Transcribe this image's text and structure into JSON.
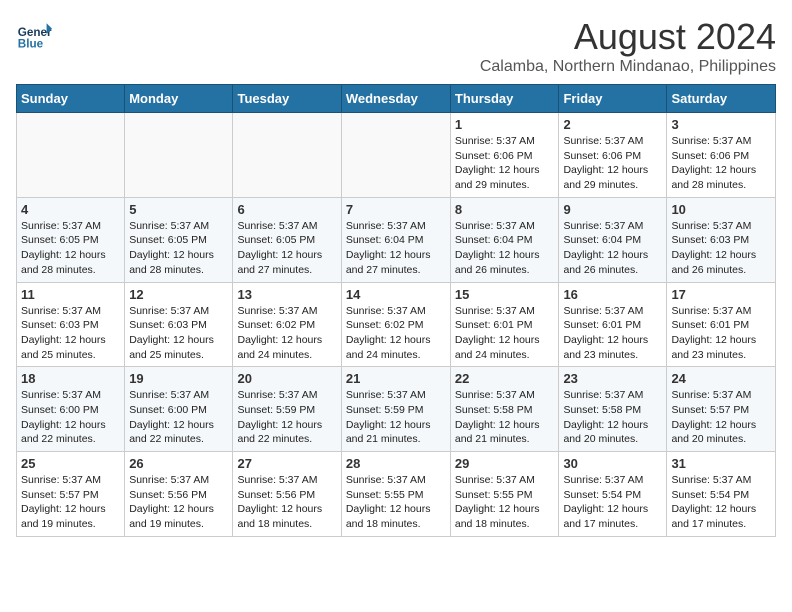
{
  "logo": {
    "line1": "General",
    "line2": "Blue"
  },
  "header": {
    "month_year": "August 2024",
    "location": "Calamba, Northern Mindanao, Philippines"
  },
  "weekdays": [
    "Sunday",
    "Monday",
    "Tuesday",
    "Wednesday",
    "Thursday",
    "Friday",
    "Saturday"
  ],
  "weeks": [
    [
      {
        "day": "",
        "info": ""
      },
      {
        "day": "",
        "info": ""
      },
      {
        "day": "",
        "info": ""
      },
      {
        "day": "",
        "info": ""
      },
      {
        "day": "1",
        "info": "Sunrise: 5:37 AM\nSunset: 6:06 PM\nDaylight: 12 hours\nand 29 minutes."
      },
      {
        "day": "2",
        "info": "Sunrise: 5:37 AM\nSunset: 6:06 PM\nDaylight: 12 hours\nand 29 minutes."
      },
      {
        "day": "3",
        "info": "Sunrise: 5:37 AM\nSunset: 6:06 PM\nDaylight: 12 hours\nand 28 minutes."
      }
    ],
    [
      {
        "day": "4",
        "info": "Sunrise: 5:37 AM\nSunset: 6:05 PM\nDaylight: 12 hours\nand 28 minutes."
      },
      {
        "day": "5",
        "info": "Sunrise: 5:37 AM\nSunset: 6:05 PM\nDaylight: 12 hours\nand 28 minutes."
      },
      {
        "day": "6",
        "info": "Sunrise: 5:37 AM\nSunset: 6:05 PM\nDaylight: 12 hours\nand 27 minutes."
      },
      {
        "day": "7",
        "info": "Sunrise: 5:37 AM\nSunset: 6:04 PM\nDaylight: 12 hours\nand 27 minutes."
      },
      {
        "day": "8",
        "info": "Sunrise: 5:37 AM\nSunset: 6:04 PM\nDaylight: 12 hours\nand 26 minutes."
      },
      {
        "day": "9",
        "info": "Sunrise: 5:37 AM\nSunset: 6:04 PM\nDaylight: 12 hours\nand 26 minutes."
      },
      {
        "day": "10",
        "info": "Sunrise: 5:37 AM\nSunset: 6:03 PM\nDaylight: 12 hours\nand 26 minutes."
      }
    ],
    [
      {
        "day": "11",
        "info": "Sunrise: 5:37 AM\nSunset: 6:03 PM\nDaylight: 12 hours\nand 25 minutes."
      },
      {
        "day": "12",
        "info": "Sunrise: 5:37 AM\nSunset: 6:03 PM\nDaylight: 12 hours\nand 25 minutes."
      },
      {
        "day": "13",
        "info": "Sunrise: 5:37 AM\nSunset: 6:02 PM\nDaylight: 12 hours\nand 24 minutes."
      },
      {
        "day": "14",
        "info": "Sunrise: 5:37 AM\nSunset: 6:02 PM\nDaylight: 12 hours\nand 24 minutes."
      },
      {
        "day": "15",
        "info": "Sunrise: 5:37 AM\nSunset: 6:01 PM\nDaylight: 12 hours\nand 24 minutes."
      },
      {
        "day": "16",
        "info": "Sunrise: 5:37 AM\nSunset: 6:01 PM\nDaylight: 12 hours\nand 23 minutes."
      },
      {
        "day": "17",
        "info": "Sunrise: 5:37 AM\nSunset: 6:01 PM\nDaylight: 12 hours\nand 23 minutes."
      }
    ],
    [
      {
        "day": "18",
        "info": "Sunrise: 5:37 AM\nSunset: 6:00 PM\nDaylight: 12 hours\nand 22 minutes."
      },
      {
        "day": "19",
        "info": "Sunrise: 5:37 AM\nSunset: 6:00 PM\nDaylight: 12 hours\nand 22 minutes."
      },
      {
        "day": "20",
        "info": "Sunrise: 5:37 AM\nSunset: 5:59 PM\nDaylight: 12 hours\nand 22 minutes."
      },
      {
        "day": "21",
        "info": "Sunrise: 5:37 AM\nSunset: 5:59 PM\nDaylight: 12 hours\nand 21 minutes."
      },
      {
        "day": "22",
        "info": "Sunrise: 5:37 AM\nSunset: 5:58 PM\nDaylight: 12 hours\nand 21 minutes."
      },
      {
        "day": "23",
        "info": "Sunrise: 5:37 AM\nSunset: 5:58 PM\nDaylight: 12 hours\nand 20 minutes."
      },
      {
        "day": "24",
        "info": "Sunrise: 5:37 AM\nSunset: 5:57 PM\nDaylight: 12 hours\nand 20 minutes."
      }
    ],
    [
      {
        "day": "25",
        "info": "Sunrise: 5:37 AM\nSunset: 5:57 PM\nDaylight: 12 hours\nand 19 minutes."
      },
      {
        "day": "26",
        "info": "Sunrise: 5:37 AM\nSunset: 5:56 PM\nDaylight: 12 hours\nand 19 minutes."
      },
      {
        "day": "27",
        "info": "Sunrise: 5:37 AM\nSunset: 5:56 PM\nDaylight: 12 hours\nand 18 minutes."
      },
      {
        "day": "28",
        "info": "Sunrise: 5:37 AM\nSunset: 5:55 PM\nDaylight: 12 hours\nand 18 minutes."
      },
      {
        "day": "29",
        "info": "Sunrise: 5:37 AM\nSunset: 5:55 PM\nDaylight: 12 hours\nand 18 minutes."
      },
      {
        "day": "30",
        "info": "Sunrise: 5:37 AM\nSunset: 5:54 PM\nDaylight: 12 hours\nand 17 minutes."
      },
      {
        "day": "31",
        "info": "Sunrise: 5:37 AM\nSunset: 5:54 PM\nDaylight: 12 hours\nand 17 minutes."
      }
    ]
  ]
}
